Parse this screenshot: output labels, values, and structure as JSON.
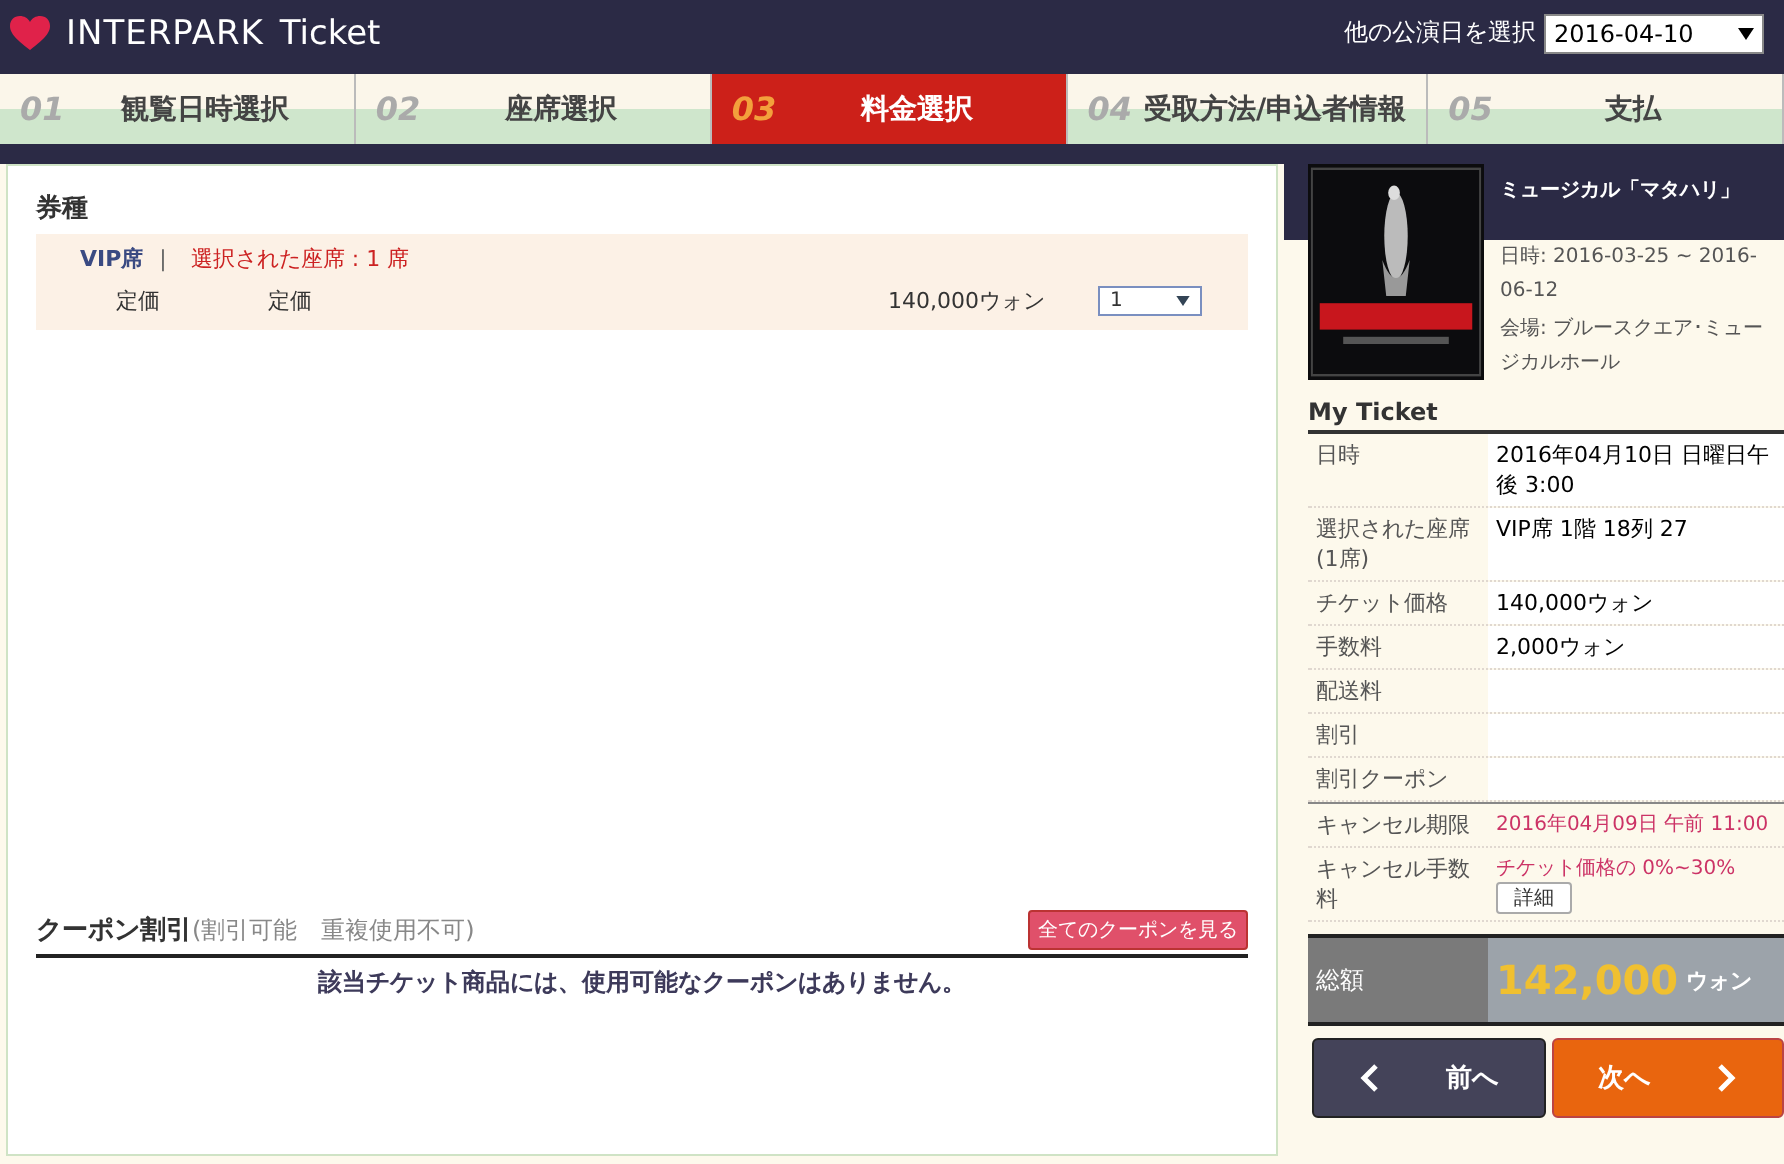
{
  "header": {
    "brand": "INTERPARK",
    "product": "Ticket",
    "date_label": "他の公演日を選択",
    "date_value": "2016-04-10"
  },
  "steps": [
    {
      "number": "01",
      "label": "観覧日時選択",
      "selected": false
    },
    {
      "number": "02",
      "label": "座席選択",
      "selected": false
    },
    {
      "number": "03",
      "label": "料金選択",
      "selected": true
    },
    {
      "number": "04",
      "label": "受取方法/申込者情報",
      "selected": false
    },
    {
      "number": "05",
      "label": "支払",
      "selected": false
    }
  ],
  "ticket_types": {
    "title": "券種",
    "groups": [
      {
        "grade": "VIP席",
        "separator": "|",
        "selection": "選択された座席 : 1 席",
        "rows": [
          {
            "type": "定価",
            "name": "定価",
            "price": "140,000ウォン",
            "quantity": "1"
          }
        ]
      }
    ]
  },
  "coupons": {
    "title": "クーポン割引",
    "note": "(割引可能　重複使用不可)",
    "button": "全てのクーポンを見る",
    "empty_message": "該当チケット商品には、使用可能なクーポンはありません。"
  },
  "show": {
    "kind": "picture",
    "title": "ミュージカル「マタハリ」",
    "date": "日時: 2016-03-25 ~ 2016-06-12",
    "venue": "会場: ブルースクエア･ミュージカルホール"
  },
  "my_ticket": {
    "title": "My Ticket",
    "rows": [
      {
        "label": "日時",
        "value": "2016年04月10日 日曜日午後 3:00",
        "kind": "plain"
      },
      {
        "label": "選択された座席(1席)",
        "value": "VIP席 1階 18列 27",
        "kind": "plain"
      },
      {
        "label": "チケット価格",
        "value": "140,000ウォン",
        "kind": "plain"
      },
      {
        "label": "手数料",
        "value": "2,000ウォン",
        "kind": "plain"
      },
      {
        "label": "配送料",
        "kind": "plain"
      },
      {
        "label": "割引",
        "kind": "plain"
      },
      {
        "label": "割引クーポン",
        "kind": "plain"
      },
      {
        "label": "キャンセル期限",
        "value": "2016年04月09日 午前 11:00",
        "kind": "notice"
      },
      {
        "label": "キャンセル手数料",
        "value": "チケット価格の 0%~30%",
        "kind": "notice",
        "button": "詳細"
      }
    ]
  },
  "total": {
    "label": "総額",
    "amount": "142,000",
    "unit": "ウォン"
  },
  "nav": {
    "prev": "前へ",
    "next": "次へ"
  }
}
